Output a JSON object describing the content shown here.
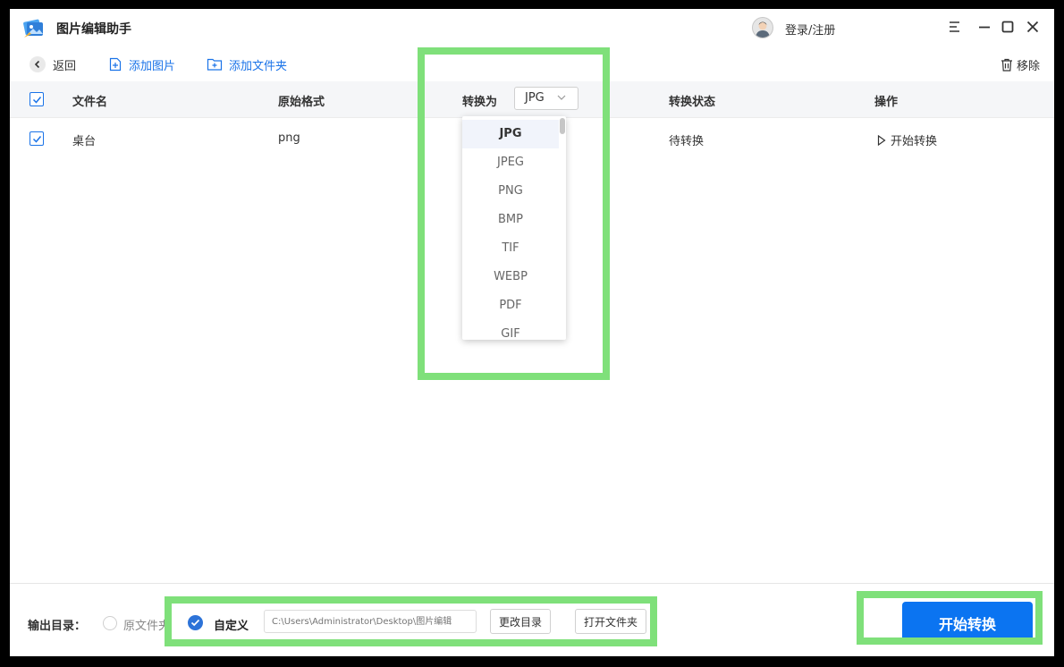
{
  "app": {
    "title": "图片编辑助手",
    "login_label": "登录/注册"
  },
  "toolbar": {
    "back_label": "返回",
    "add_image_label": "添加图片",
    "add_folder_label": "添加文件夹",
    "remove_label": "移除"
  },
  "table": {
    "headers": {
      "filename": "文件名",
      "original_format": "原始格式",
      "convert_to": "转换为",
      "status": "转换状态",
      "action": "操作"
    },
    "target_format": "JPG",
    "rows": [
      {
        "filename": "桌台",
        "format": "png",
        "status": "待转换",
        "action": "开始转换",
        "checked": true
      }
    ]
  },
  "format_dropdown": {
    "options": [
      "JPG",
      "JPEG",
      "PNG",
      "BMP",
      "TIF",
      "WEBP",
      "PDF",
      "GIF"
    ],
    "selected": "JPG"
  },
  "output": {
    "label": "输出目录：",
    "option_original": "原文件夹",
    "option_custom": "自定义",
    "path_placeholder": "C:\\Users\\Administrator\\Desktop\\图片编辑",
    "change_dir_label": "更改目录",
    "open_folder_label": "打开文件夹"
  },
  "start_button_label": "开始转换",
  "colors": {
    "accent": "#1a73e8",
    "start_button": "#0b74f1",
    "highlight": "#7fe07a"
  }
}
